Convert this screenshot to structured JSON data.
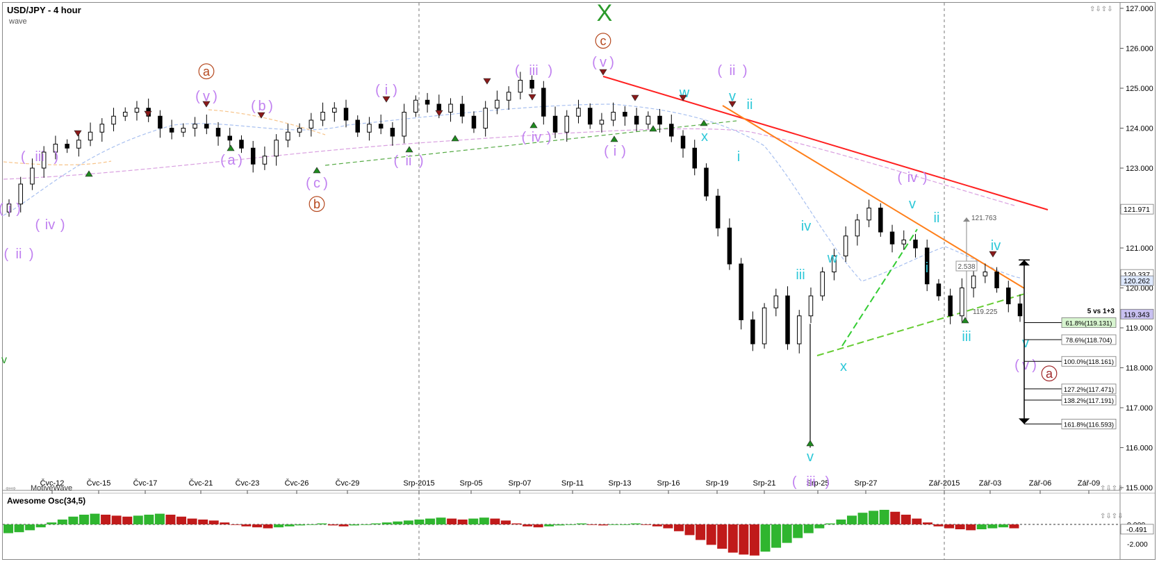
{
  "window": {
    "symbol_title": "USD/JPY - 4 hour",
    "study_label": "wave",
    "brand": "MotiveWave",
    "oscillator_label": "Awesome Osc(34,5)"
  },
  "colors": {
    "bg": "#ffffff",
    "candle": "#000000",
    "red_trend": "#ff2020",
    "orange_trend": "#ff7f1a",
    "green_trend": "#66cc33",
    "ma_blue": "#a8c0f0",
    "ma_pink": "#d9a0e0",
    "wave_purple": "#c080f0",
    "wave_cyan": "#2ec8d8",
    "wave_brown": "#b5481e",
    "wave_green": "#2a9a2a",
    "osc_green": "#2fb52f",
    "osc_red": "#c01a1a",
    "fib_fill": "#d8f5d0"
  },
  "chart_data": {
    "type": "line",
    "ylim": [
      114.8,
      127.1
    ],
    "price_ticks": [
      "127.000",
      "126.000",
      "125.000",
      "124.000",
      "123.000",
      "122.000",
      "121.000",
      "120.000",
      "119.000",
      "118.000",
      "117.000",
      "116.000",
      "115.000"
    ],
    "price_tick_values": [
      127,
      126,
      125,
      124,
      123,
      122,
      121,
      120,
      119,
      118,
      117,
      116,
      115
    ],
    "x_ticks": [
      "Čvc-12",
      "Čvc-15",
      "Čvc-17",
      "Čvc-21",
      "Čvc-23",
      "Čvc-26",
      "Čvc-29",
      "Srp-2015",
      "Srp-05",
      "Srp-07",
      "Srp-11",
      "Srp-13",
      "Srp-16",
      "Srp-19",
      "Srp-21",
      "Srp-25",
      "Srp-27",
      "Zář-2015",
      "Zář-03",
      "Zář-06",
      "Zář-09"
    ],
    "price_badges": [
      {
        "label": "121.971",
        "value": 121.971,
        "style": "plain"
      },
      {
        "label": "120.337",
        "value": 120.337,
        "style": "plain"
      },
      {
        "label": "120.262",
        "value": 120.18,
        "style": "blue"
      },
      {
        "label": "119.343",
        "value": 119.343,
        "style": "purple"
      }
    ],
    "close_series": [
      122.1,
      122.6,
      123.0,
      123.4,
      123.6,
      123.5,
      123.7,
      123.9,
      124.1,
      124.3,
      124.4,
      124.5,
      124.3,
      124.0,
      123.9,
      124.0,
      124.1,
      124.0,
      123.8,
      123.7,
      123.5,
      123.1,
      123.3,
      123.7,
      123.9,
      124.0,
      124.2,
      124.4,
      124.5,
      124.2,
      123.9,
      124.1,
      124.0,
      123.8,
      124.4,
      124.7,
      124.6,
      124.4,
      124.6,
      124.3,
      124.0,
      124.5,
      124.7,
      124.9,
      125.2,
      125.0,
      124.3,
      123.9,
      124.3,
      124.5,
      124.1,
      124.2,
      124.4,
      124.3,
      124.1,
      124.3,
      124.1,
      123.8,
      123.5,
      123.0,
      122.3,
      121.5,
      120.6,
      119.2,
      118.6,
      119.5,
      119.8,
      118.6,
      119.3,
      119.8,
      120.4,
      120.8,
      121.3,
      121.7,
      122.0,
      121.4,
      121.1,
      121.2,
      121.0,
      120.1,
      119.8,
      119.3,
      120.0,
      120.3,
      120.4,
      120.0,
      119.6,
      119.3
    ],
    "annotations": {
      "title_label": "X",
      "big_c": "c",
      "big_a": "a",
      "big_b": "b",
      "minor_a": "a",
      "minor_b": "b",
      "minor_c": "c",
      "rom_i": "i",
      "rom_ii": "ii",
      "rom_iii": "iii",
      "rom_iv": "iv",
      "rom_v": "v",
      "cyan_w": "w",
      "cyan_v": "v",
      "cyan_ii": "ii",
      "cyan_i": "i",
      "cyan_iii": "iii",
      "cyan_iv": "iv",
      "cyan_x": "x",
      "green_v": "v",
      "ruler_top": "121.763",
      "ruler_mid": "2.538",
      "ruler_bot": "119.225",
      "fib_title": "5 vs 1+3"
    },
    "fib_levels": [
      {
        "label": "61.8%(119.131)",
        "value": 119.131,
        "highlight": true
      },
      {
        "label": "78.6%(118.704)",
        "value": 118.704,
        "highlight": false
      },
      {
        "label": "100.0%(118.161)",
        "value": 118.161,
        "highlight": false
      },
      {
        "label": "127.2%(117.471)",
        "value": 117.471,
        "highlight": false
      },
      {
        "label": "138.2%(117.191)",
        "value": 117.191,
        "highlight": false
      },
      {
        "label": "161.8%(116.593)",
        "value": 116.593,
        "highlight": false
      }
    ],
    "oscillator": {
      "ticks": [
        "0.000",
        "-2.000"
      ],
      "tick_values": [
        0,
        -2
      ],
      "badge": "-0.491",
      "badge_value": -0.491,
      "values": [
        -0.9,
        -0.8,
        -0.6,
        -0.3,
        0.2,
        0.5,
        0.8,
        1.0,
        1.1,
        1.0,
        0.9,
        0.8,
        0.9,
        1.0,
        1.1,
        1.0,
        0.8,
        0.6,
        0.5,
        0.4,
        0.2,
        0.0,
        -0.2,
        -0.3,
        -0.4,
        -0.3,
        -0.2,
        -0.1,
        0.0,
        0.1,
        -0.1,
        -0.2,
        -0.1,
        0.0,
        0.1,
        0.2,
        0.3,
        0.4,
        0.5,
        0.6,
        0.7,
        0.6,
        0.5,
        0.6,
        0.7,
        0.6,
        0.4,
        0.1,
        -0.2,
        -0.3,
        -0.2,
        -0.1,
        0.0,
        0.1,
        0.0,
        -0.1,
        0.0,
        0.0,
        0.1,
        0.0,
        -0.2,
        -0.4,
        -0.7,
        -1.1,
        -1.6,
        -2.1,
        -2.5,
        -2.9,
        -3.1,
        -3.2,
        -2.8,
        -2.4,
        -1.9,
        -1.4,
        -0.9,
        -0.4,
        0.1,
        0.5,
        0.9,
        1.2,
        1.4,
        1.5,
        1.3,
        1.0,
        0.6,
        0.2,
        -0.2,
        -0.4,
        -0.5,
        -0.6,
        -0.5,
        -0.4,
        -0.3,
        -0.4
      ]
    }
  }
}
